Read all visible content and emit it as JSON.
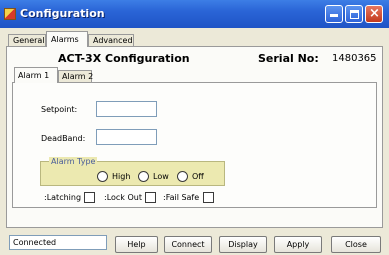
{
  "window": {
    "title": "Configuration"
  },
  "tabs": [
    {
      "label": "General"
    },
    {
      "label": "Alarms",
      "active": true
    },
    {
      "label": "Advanced"
    }
  ],
  "header": {
    "model": "ACT-3X Configuration",
    "serial_label": "Serial No:",
    "serial_value": "1480365"
  },
  "alarm_tabs": [
    {
      "label": "Alarm 1",
      "active": true
    },
    {
      "label": "Alarm 2"
    }
  ],
  "fields": {
    "setpoint": {
      "label": "Setpoint:",
      "value": ""
    },
    "deadband": {
      "label": "DeadBand:",
      "value": ""
    }
  },
  "alarm_type": {
    "caption": "Alarm Type",
    "options": [
      {
        "label": "High",
        "selected": false
      },
      {
        "label": "Low",
        "selected": false
      },
      {
        "label": "Off",
        "selected": false
      }
    ]
  },
  "checkboxes": [
    {
      "label": ":Latching",
      "checked": false
    },
    {
      "label": ":Lock Out",
      "checked": false
    },
    {
      "label": ":Fail Safe",
      "checked": false
    }
  ],
  "status": "Connected",
  "buttons": {
    "help": "Help",
    "connect": "Connect",
    "display": "Display",
    "apply": "Apply",
    "close": "Close"
  }
}
